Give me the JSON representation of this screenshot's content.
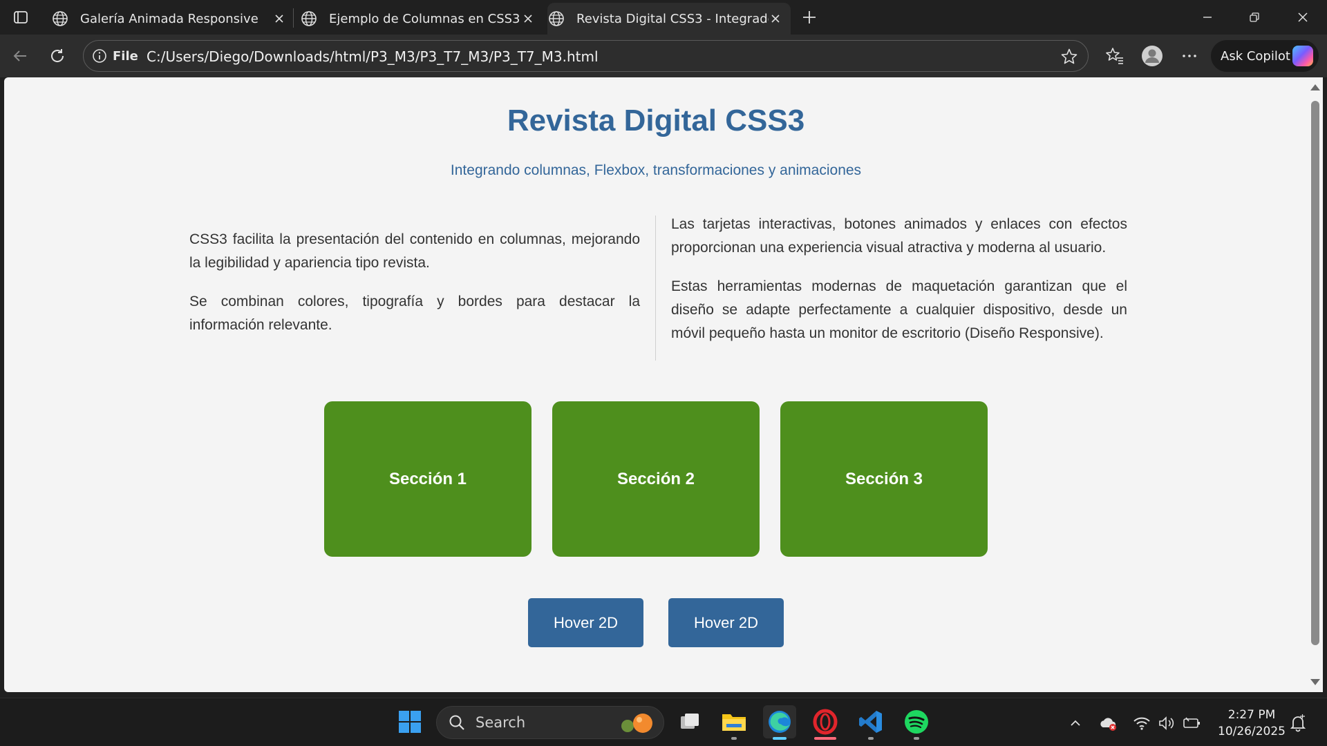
{
  "browser": {
    "tabs": [
      {
        "title": "Galería Animada Responsive"
      },
      {
        "title": "Ejemplo de Columnas en CSS3"
      },
      {
        "title": "Revista Digital CSS3 - Integrador"
      }
    ],
    "address": {
      "scheme_label": "File",
      "url": "C:/Users/Diego/Downloads/html/P3_M3/P3_T7_M3/P3_T7_M3.html"
    },
    "copilot_label": "Ask Copilot"
  },
  "page": {
    "title": "Revista Digital CSS3",
    "subtitle": "Integrando columnas, Flexbox, transformaciones y animaciones",
    "left_column": [
      "CSS3 facilita la presentación del contenido en columnas, mejorando la legibilidad y apariencia tipo revista.",
      "Se combinan colores, tipografía y bordes para destacar la información relevante."
    ],
    "right_column": [
      "Las tarjetas interactivas, botones animados y enlaces con efectos proporcionan una experiencia visual atractiva y moderna al usuario.",
      "Estas herramientas modernas de maquetación garantizan que el diseño se adapte perfectamente a cualquier dispositivo, desde un móvil pequeño hasta un monitor de escritorio (Diseño Responsive)."
    ],
    "cards": [
      {
        "label": "Sección 1"
      },
      {
        "label": "Sección 2"
      },
      {
        "label": "Sección 3"
      }
    ],
    "buttons": [
      {
        "label": "Hover 2D"
      },
      {
        "label": "Hover 2D"
      }
    ],
    "colors": {
      "heading": "#336699",
      "card": "#4e8f1d",
      "button": "#336699",
      "background": "#f4f4f4"
    }
  },
  "taskbar": {
    "search_placeholder": "Search",
    "time": "2:27 PM",
    "date": "10/26/2025",
    "apps": [
      "start-icon",
      "task-view-icon",
      "file-explorer-icon",
      "edge-icon",
      "opera-icon",
      "vscode-icon",
      "spotify-icon"
    ]
  }
}
